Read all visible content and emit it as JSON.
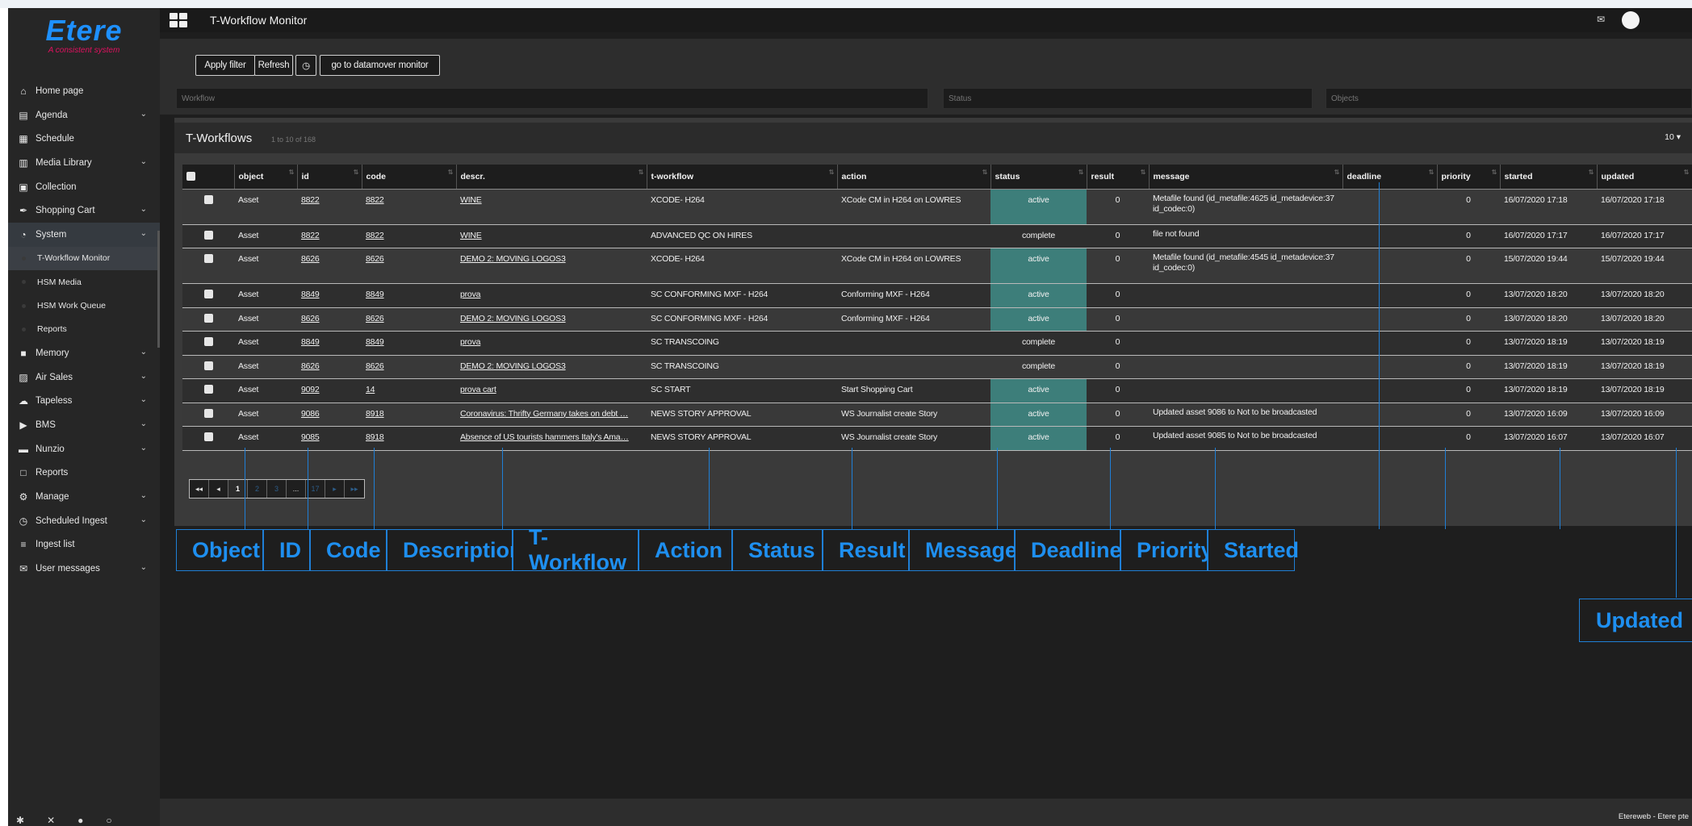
{
  "brand": {
    "name": "Etere",
    "tagline": "A consistent system"
  },
  "topbar": {
    "title": "T-Workflow Monitor"
  },
  "sidebar": {
    "items": [
      {
        "label": "Home page",
        "icon": "home-icon",
        "glyph": "⌂",
        "chevron": false
      },
      {
        "label": "Agenda",
        "icon": "book-icon",
        "glyph": "▤",
        "chevron": true
      },
      {
        "label": "Schedule",
        "icon": "calendar-icon",
        "glyph": "▦",
        "chevron": false
      },
      {
        "label": "Media Library",
        "icon": "film-icon",
        "glyph": "▥",
        "chevron": true
      },
      {
        "label": "Collection",
        "icon": "collection-icon",
        "glyph": "▣",
        "chevron": false
      },
      {
        "label": "Shopping Cart",
        "icon": "cart-icon",
        "glyph": "✒",
        "chevron": true
      },
      {
        "label": "System",
        "icon": "dashboard-icon",
        "glyph": "◔",
        "chevron": true,
        "active": true
      }
    ],
    "subitems": [
      {
        "label": "T-Workflow Monitor",
        "active": true
      },
      {
        "label": "HSM Media"
      },
      {
        "label": "HSM Work Queue"
      },
      {
        "label": "Reports"
      }
    ],
    "items2": [
      {
        "label": "Memory",
        "icon": "memory-icon",
        "glyph": "■",
        "chevron": true
      },
      {
        "label": "Air Sales",
        "icon": "briefcase-icon",
        "glyph": "▨",
        "chevron": true
      },
      {
        "label": "Tapeless",
        "icon": "cloud-upload-icon",
        "glyph": "☁",
        "chevron": true
      },
      {
        "label": "BMS",
        "icon": "video-camera-icon",
        "glyph": "▶",
        "chevron": true
      },
      {
        "label": "Nunzio",
        "icon": "folder-icon",
        "glyph": "▬",
        "chevron": true
      },
      {
        "label": "Reports",
        "icon": "document-icon",
        "glyph": "□",
        "chevron": false
      },
      {
        "label": "Manage",
        "icon": "cogs-icon",
        "glyph": "⚙",
        "chevron": true
      },
      {
        "label": "Scheduled Ingest",
        "icon": "clock-icon",
        "glyph": "◷",
        "chevron": true
      },
      {
        "label": "Ingest list",
        "icon": "list-icon",
        "glyph": "≡",
        "chevron": false
      },
      {
        "label": "User messages",
        "icon": "envelope-icon",
        "glyph": "✉",
        "chevron": true
      }
    ]
  },
  "toolbar": {
    "apply_filter": "Apply filter",
    "refresh": "Refresh",
    "datamover": "go to datamover monitor"
  },
  "filters": {
    "workflow_placeholder": "Workflow",
    "status_placeholder": "Status",
    "objects_placeholder": "Objects"
  },
  "panel": {
    "title": "T-Workflows",
    "subtitle": "1 to 10 of 168",
    "page_size": "10 ▾"
  },
  "table": {
    "columns": [
      "object",
      "id",
      "code",
      "descr.",
      "t-workflow",
      "action",
      "status",
      "result",
      "message",
      "deadline",
      "priority",
      "started",
      "updated"
    ],
    "rows": [
      {
        "object": "Asset",
        "id": "8822",
        "code": "8822",
        "descr": "WINE",
        "tworkflow": "XCODE- H264",
        "action": "XCode CM in H264 on LOWRES",
        "status": "active",
        "result": "0",
        "message": "Metafile found (id_metafile:4625 id_metadevice:37 id_codec:0)",
        "deadline": "",
        "priority": "0",
        "started": "16/07/2020 17:18",
        "updated": "16/07/2020 17:18",
        "tall": true
      },
      {
        "object": "Asset",
        "id": "8822",
        "code": "8822",
        "descr": "WINE",
        "tworkflow": "ADVANCED QC ON HIRES",
        "action": "",
        "status": "complete",
        "result": "0",
        "message": "file not found",
        "deadline": "",
        "priority": "0",
        "started": "16/07/2020 17:17",
        "updated": "16/07/2020 17:17"
      },
      {
        "object": "Asset",
        "id": "8626",
        "code": "8626",
        "descr": "DEMO 2: MOVING LOGOS3",
        "tworkflow": "XCODE- H264",
        "action": "XCode CM in H264 on LOWRES",
        "status": "active",
        "result": "0",
        "message": "Metafile found (id_metafile:4545 id_metadevice:37 id_codec:0)",
        "deadline": "",
        "priority": "0",
        "started": "15/07/2020 19:44",
        "updated": "15/07/2020 19:44",
        "tall": true
      },
      {
        "object": "Asset",
        "id": "8849",
        "code": "8849",
        "descr": "prova",
        "tworkflow": "SC CONFORMING MXF - H264",
        "action": "Conforming MXF - H264",
        "status": "active",
        "result": "0",
        "message": "",
        "deadline": "",
        "priority": "0",
        "started": "13/07/2020 18:20",
        "updated": "13/07/2020 18:20"
      },
      {
        "object": "Asset",
        "id": "8626",
        "code": "8626",
        "descr": "DEMO 2: MOVING LOGOS3",
        "tworkflow": "SC CONFORMING MXF - H264",
        "action": "Conforming MXF - H264",
        "status": "active",
        "result": "0",
        "message": "",
        "deadline": "",
        "priority": "0",
        "started": "13/07/2020 18:20",
        "updated": "13/07/2020 18:20"
      },
      {
        "object": "Asset",
        "id": "8849",
        "code": "8849",
        "descr": "prova",
        "tworkflow": "SC TRANSCOING",
        "action": "",
        "status": "complete",
        "result": "0",
        "message": "",
        "deadline": "",
        "priority": "0",
        "started": "13/07/2020 18:19",
        "updated": "13/07/2020 18:19"
      },
      {
        "object": "Asset",
        "id": "8626",
        "code": "8626",
        "descr": "DEMO 2: MOVING LOGOS3",
        "tworkflow": "SC TRANSCOING",
        "action": "",
        "status": "complete",
        "result": "0",
        "message": "",
        "deadline": "",
        "priority": "0",
        "started": "13/07/2020 18:19",
        "updated": "13/07/2020 18:19"
      },
      {
        "object": "Asset",
        "id": "9092",
        "code": "14",
        "descr": "prova cart",
        "tworkflow": "SC START",
        "action": "Start Shopping Cart",
        "status": "active",
        "result": "0",
        "message": "",
        "deadline": "",
        "priority": "0",
        "started": "13/07/2020 18:19",
        "updated": "13/07/2020 18:19"
      },
      {
        "object": "Asset",
        "id": "9086",
        "code": "8918",
        "descr": "Coronavirus: Thrifty Germany takes on debt …",
        "tworkflow": "NEWS STORY APPROVAL",
        "action": "WS Journalist create Story",
        "status": "active",
        "result": "0",
        "message": "Updated asset 9086 to Not to be broadcasted",
        "deadline": "",
        "priority": "0",
        "started": "13/07/2020 16:09",
        "updated": "13/07/2020 16:09"
      },
      {
        "object": "Asset",
        "id": "9085",
        "code": "8918",
        "descr": "Absence of US tourists hammers Italy's Ama…",
        "tworkflow": "NEWS STORY APPROVAL",
        "action": "WS Journalist create Story",
        "status": "active",
        "result": "0",
        "message": "Updated asset 9085 to Not to be broadcasted",
        "deadline": "",
        "priority": "0",
        "started": "13/07/2020 16:07",
        "updated": "13/07/2020 16:07"
      }
    ]
  },
  "pagination": {
    "first": "◂◂",
    "prev": "◂",
    "current": "1",
    "p2": "2",
    "p3": "3",
    "ellipsis": "...",
    "last": "17",
    "next": "▸",
    "end": "▸▸"
  },
  "footer": {
    "credits": "Etereweb - Etere pte"
  },
  "annotations": {
    "labels": [
      "Object",
      "ID",
      "Code",
      "Description",
      "T-Workflow",
      "Action",
      "Status",
      "Result",
      "Message",
      "Deadline",
      "Priority",
      "Started"
    ],
    "updated": "Updated",
    "color": "#1e8ff0"
  }
}
